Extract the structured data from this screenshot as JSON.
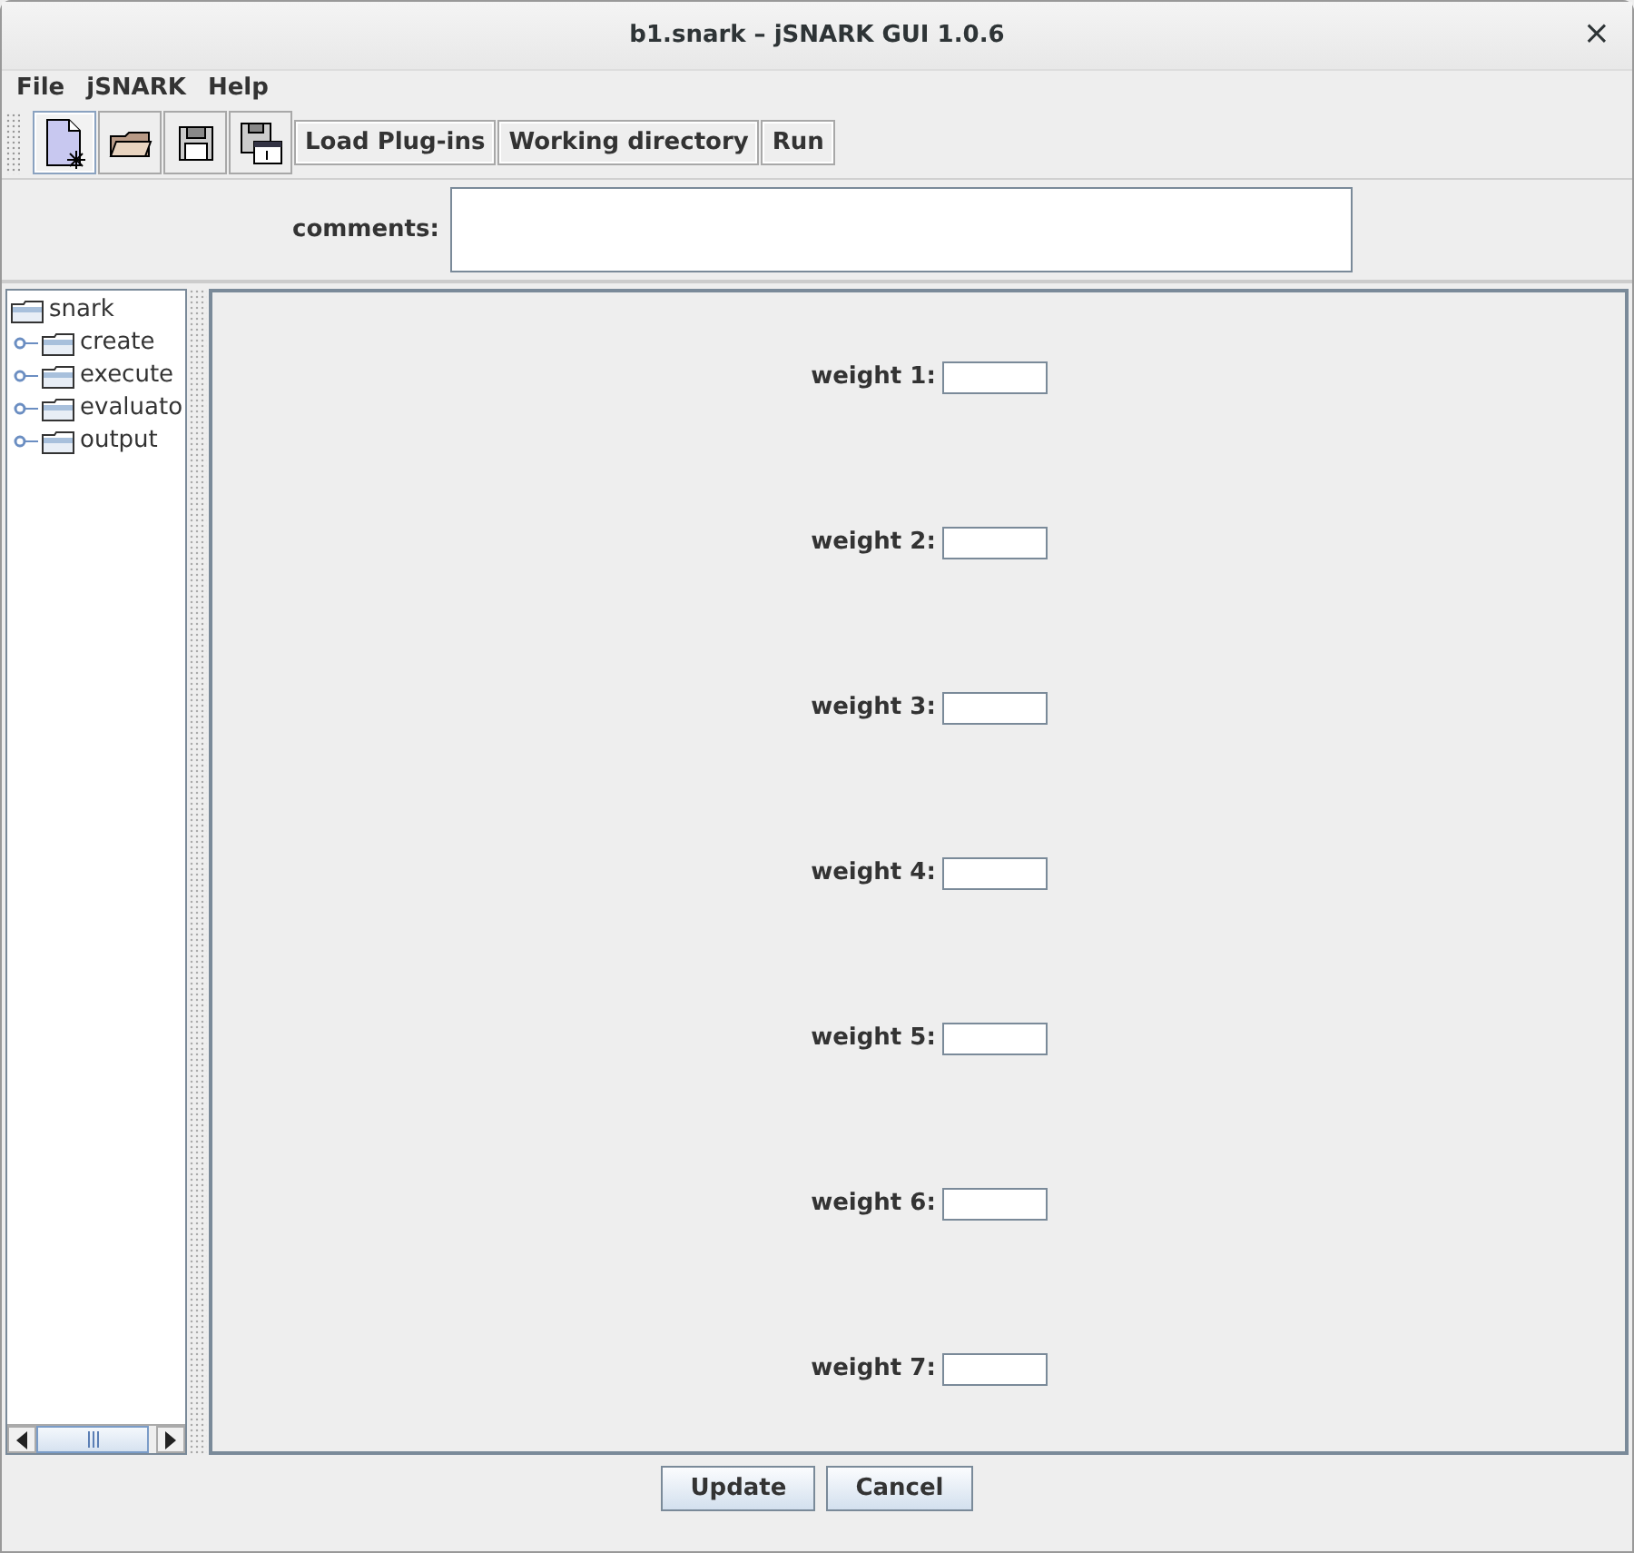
{
  "window": {
    "title": "b1.snark – jSNARK GUI 1.0.6",
    "close": "×"
  },
  "menu": [
    "File",
    "jSNARK",
    "Help"
  ],
  "toolbar": {
    "icon_buttons": [
      {
        "kind": "new",
        "selected": true
      },
      {
        "kind": "open",
        "selected": false
      },
      {
        "kind": "save",
        "selected": false
      },
      {
        "kind": "saveas",
        "selected": false
      }
    ],
    "buttons": [
      "Load Plug-ins",
      "Working directory",
      "Run"
    ]
  },
  "comments": {
    "label": "comments:"
  },
  "tree": {
    "label": "snark",
    "children": [
      {
        "label": "create",
        "expanded": false
      },
      {
        "label": "execute",
        "expanded": false
      },
      {
        "label": "evaluato",
        "expanded": false
      },
      {
        "label": "output",
        "expanded": false
      }
    ]
  },
  "weights": [
    {
      "label": "weight 1:"
    },
    {
      "label": "weight 2:"
    },
    {
      "label": "weight 3:"
    },
    {
      "label": "weight 4:"
    },
    {
      "label": "weight 5:"
    },
    {
      "label": "weight 6:"
    },
    {
      "label": "weight 7:"
    }
  ],
  "buttons": [
    "Update",
    "Cancel"
  ]
}
